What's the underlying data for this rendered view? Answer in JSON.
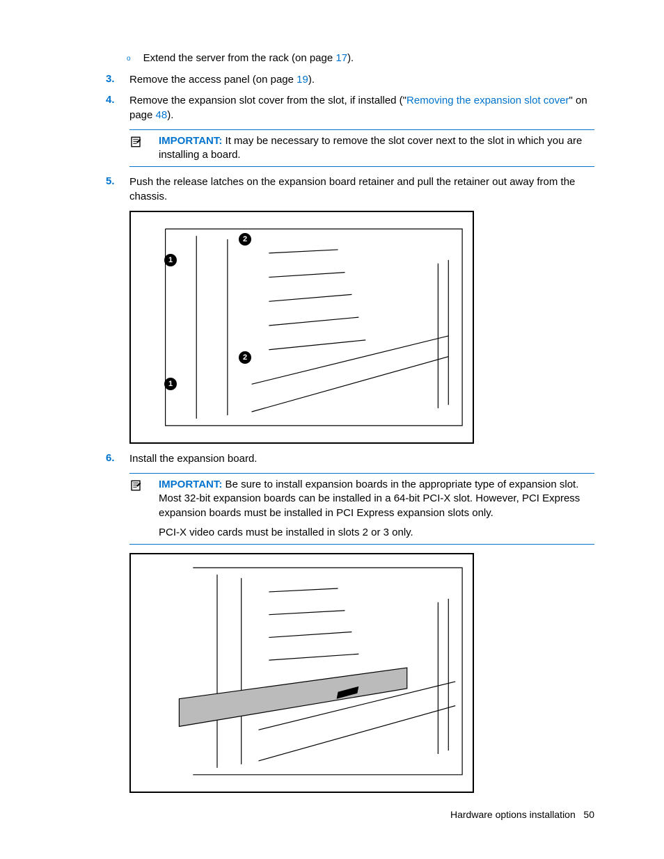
{
  "steps": {
    "sub_o": {
      "text_before": "Extend the server from the rack (on page ",
      "page_link": "17",
      "text_after": ")."
    },
    "s3": {
      "num": "3.",
      "text_before": "Remove the access panel (on page ",
      "page_link": "19",
      "text_after": ")."
    },
    "s4": {
      "num": "4.",
      "text_before": "Remove the expansion slot cover from the slot, if installed (\"",
      "link_text": "Removing the expansion slot cover",
      "mid": "\" on page ",
      "page_link": "48",
      "text_after": ")."
    },
    "s5": {
      "num": "5.",
      "text": "Push the release latches on the expansion board retainer and pull the retainer out away from the chassis."
    },
    "s6": {
      "num": "6.",
      "text": "Install the expansion board."
    }
  },
  "important1": {
    "label": "IMPORTANT:",
    "text": "  It may be necessary to remove the slot cover next to the slot in which you are installing a board."
  },
  "important2": {
    "label": "IMPORTANT:",
    "text": "  Be sure to install expansion boards in the appropriate type of expansion slot. Most 32-bit expansion boards can be installed in a 64-bit PCI-X slot. However, PCI Express expansion boards must be installed in PCI Express expansion slots only.",
    "extra": "PCI-X video cards must be installed in slots 2 or 3 only."
  },
  "figure1": {
    "callouts": [
      "1",
      "2",
      "1",
      "2"
    ],
    "alt": "[Technical line drawing: server chassis interior showing expansion board retainer with release latches marked 1 and 2, arrows indicating pull direction]"
  },
  "figure2": {
    "alt": "[Technical line drawing: server chassis interior showing expansion board being inserted into a slot, arrow indicating insertion direction]"
  },
  "footer": {
    "section": "Hardware options installation",
    "page": "50"
  }
}
